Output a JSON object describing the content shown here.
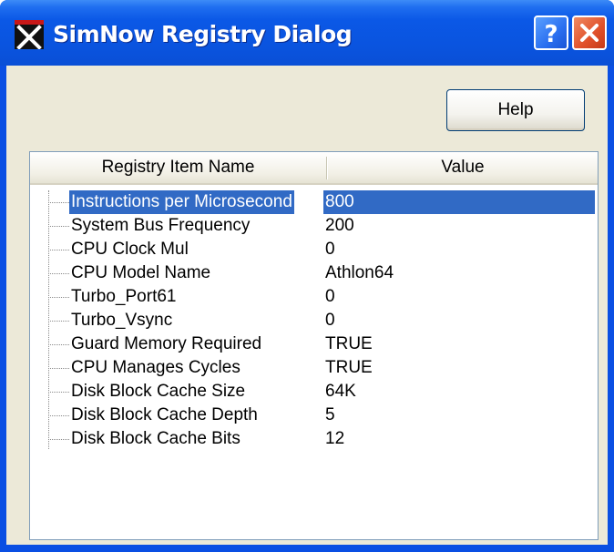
{
  "window": {
    "title": "SimNow Registry Dialog",
    "app_icon": "simnow-x-icon",
    "titlebar_buttons": [
      {
        "name": "help-icon",
        "glyph": "?"
      },
      {
        "name": "close-icon",
        "glyph": "X"
      }
    ]
  },
  "toolbar": {
    "help_label": "Help"
  },
  "list": {
    "columns": [
      "Registry Item Name",
      "Value"
    ],
    "selected_index": 0,
    "rows": [
      {
        "name": "Instructions per Microsecond",
        "value": "800"
      },
      {
        "name": "System Bus Frequency",
        "value": "200"
      },
      {
        "name": "CPU Clock Mul",
        "value": "0"
      },
      {
        "name": "CPU Model Name",
        "value": "Athlon64"
      },
      {
        "name": "Turbo_Port61",
        "value": "0"
      },
      {
        "name": "Turbo_Vsync",
        "value": "0"
      },
      {
        "name": "Guard Memory Required",
        "value": "TRUE"
      },
      {
        "name": "CPU Manages Cycles",
        "value": "TRUE"
      },
      {
        "name": "Disk Block Cache Size",
        "value": "64K"
      },
      {
        "name": "Disk Block Cache Depth",
        "value": "5"
      },
      {
        "name": "Disk Block Cache Bits",
        "value": "12"
      }
    ]
  },
  "colors": {
    "titlebar": "#0a54df",
    "selection": "#316ac5",
    "dialog_bg": "#ece9d8",
    "close_button": "#e0502a"
  }
}
